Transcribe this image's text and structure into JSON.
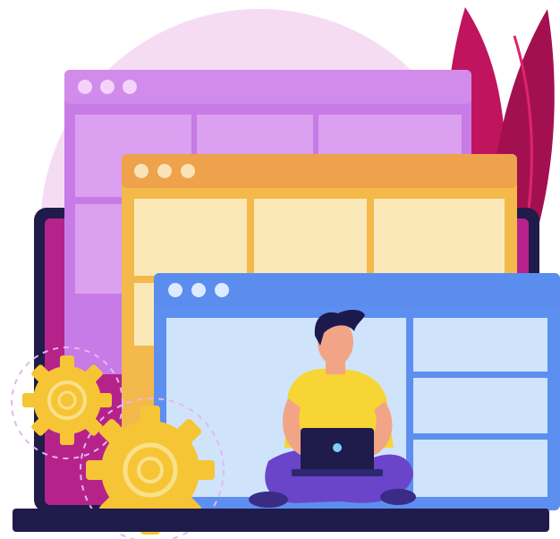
{
  "illustration": {
    "subject": "developer-with-laptop-and-browser-windows",
    "icons": [
      "window-dots-icon",
      "gear-icon",
      "leaf-icon",
      "laptop-icon"
    ],
    "colors": {
      "background_circle": "#f6dcf3",
      "leaf_dark": "#b0135a",
      "leaf_light": "#e0236e",
      "monitor_frame": "#1f1b4b",
      "window_purple": "#c77be6",
      "window_purple_bar": "#d18bea",
      "window_purple_cell": "#dba0ef",
      "window_yellow": "#f3b94b",
      "window_yellow_bar": "#eea24b",
      "window_yellow_cell": "#fbe8b8",
      "window_blue": "#5d8ff0",
      "window_blue_bar": "#5b8def",
      "window_blue_cell": "#cfe3fb",
      "gear": "#f6c535",
      "shirt": "#f6d534",
      "pants": "#6a44c9",
      "skin": "#f2a586",
      "hair": "#1c1a4d",
      "laptop": "#1f1b4b",
      "base_bar": "#1f1b4b"
    }
  }
}
